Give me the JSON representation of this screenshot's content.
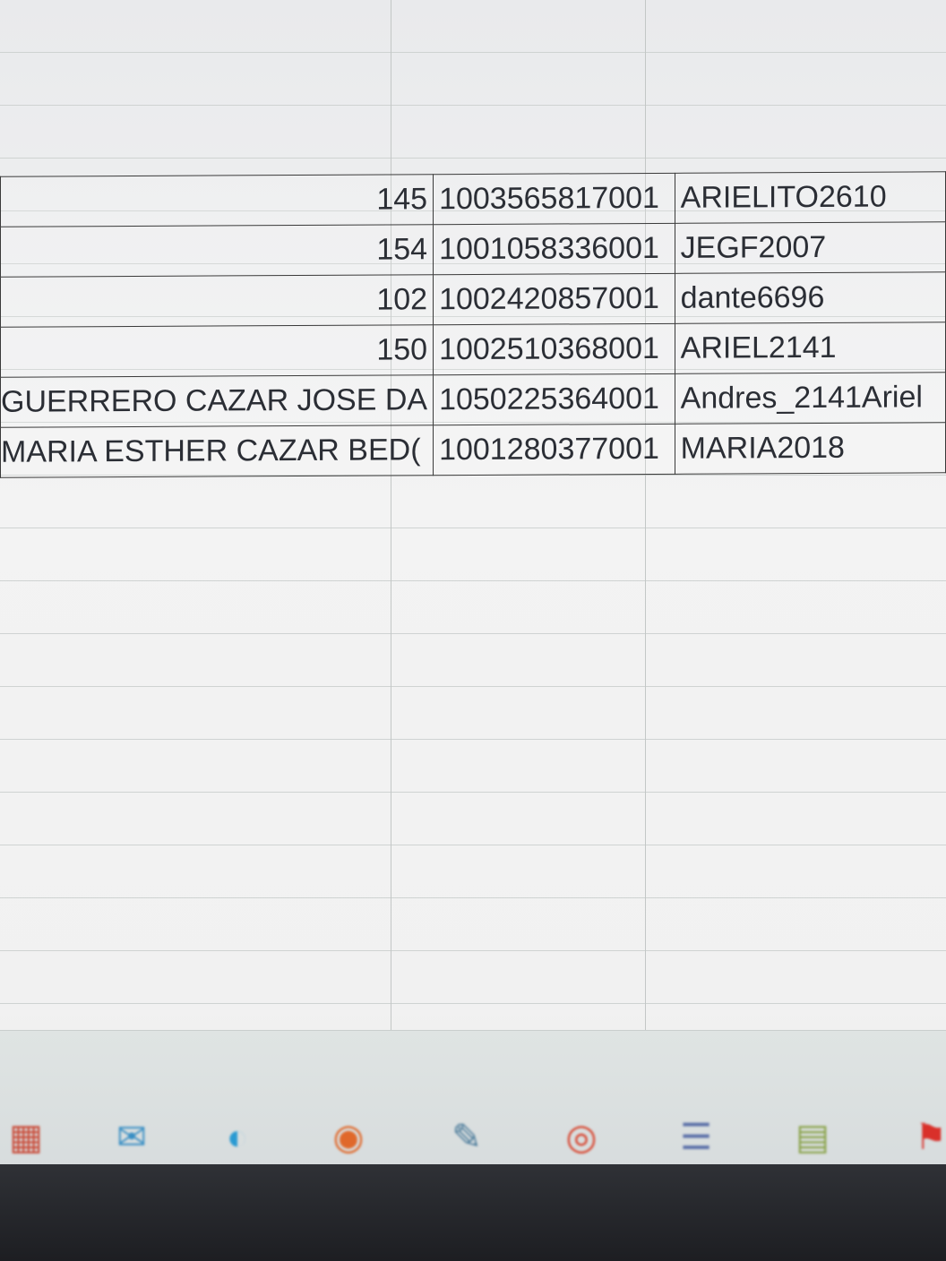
{
  "sheet": {
    "rows": [
      {
        "a": "145",
        "b": "1003565817001",
        "c": "ARIELITO2610"
      },
      {
        "a": "154",
        "b": "1001058336001",
        "c": "JEGF2007"
      },
      {
        "a": "102",
        "b": "1002420857001",
        "c": "dante6696"
      },
      {
        "a": "150",
        "b": "1002510368001",
        "c": "ARIEL2141"
      },
      {
        "a": "GUERRERO CAZAR JOSE DA",
        "b": "1050225364001",
        "c": "Andres_2141Ariel"
      },
      {
        "a": "MARIA ESTHER CAZAR BED(",
        "b": "1001280377001",
        "c": "MARIA2018"
      }
    ]
  },
  "taskbar": {
    "icons": [
      {
        "name": "store-icon",
        "glyph": "▦",
        "color": "#c94c3a"
      },
      {
        "name": "mail-icon",
        "glyph": "✉",
        "color": "#3a8fc4"
      },
      {
        "name": "edge-icon",
        "glyph": "◐",
        "color": "#2a9ad2"
      },
      {
        "name": "firefox-icon",
        "glyph": "◉",
        "color": "#e0682a"
      },
      {
        "name": "notepad-icon",
        "glyph": "✎",
        "color": "#4a7a9a"
      },
      {
        "name": "chrome-icon",
        "glyph": "◎",
        "color": "#d8452f"
      },
      {
        "name": "settings-app-icon",
        "glyph": "☰",
        "color": "#5a6fa8"
      },
      {
        "name": "document-icon",
        "glyph": "▤",
        "color": "#8aa34a"
      },
      {
        "name": "acrobat-icon",
        "glyph": "⚑",
        "color": "#d9302a"
      }
    ]
  }
}
